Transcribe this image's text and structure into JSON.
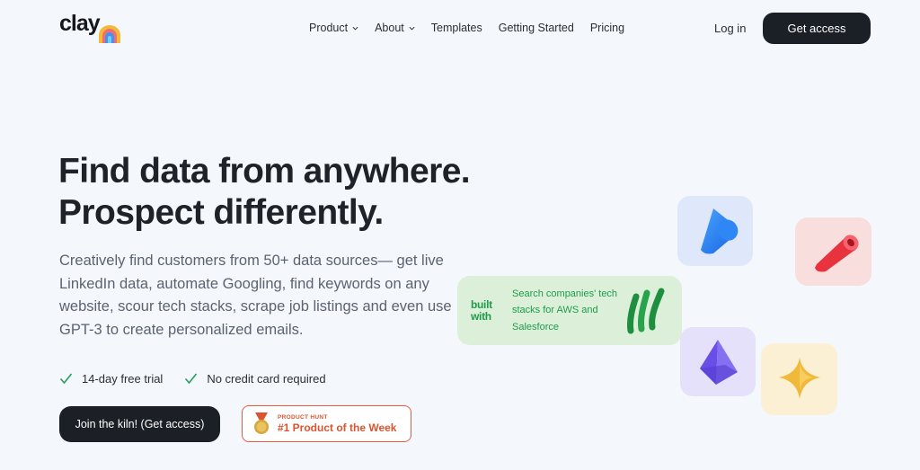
{
  "brand": {
    "name": "clay",
    "arch_colors": [
      "#f5b93a",
      "#ef6f6c",
      "#4a8ef0",
      "#6ad1f2"
    ]
  },
  "nav": {
    "items": [
      {
        "label": "Product",
        "dropdown": true
      },
      {
        "label": "About",
        "dropdown": true
      },
      {
        "label": "Templates",
        "dropdown": false
      },
      {
        "label": "Getting Started",
        "dropdown": false
      },
      {
        "label": "Pricing",
        "dropdown": false
      }
    ],
    "login_label": "Log in",
    "get_access_label": "Get access"
  },
  "hero": {
    "headline_line1": "Find data from anywhere.",
    "headline_line2": "Prospect differently.",
    "subtext": "Creatively find customers from 50+ data sources— get live LinkedIn data, automate Googling, find keywords on any website, scour tech stacks, scrape job listings and even use GPT-3 to create personalized emails.",
    "checks": [
      "14-day free trial",
      "No credit card required"
    ],
    "cta_label": "Join the kiln! (Get access)",
    "product_hunt": {
      "kicker": "PRODUCT HUNT",
      "title": "#1 Product of the Week"
    }
  },
  "integration_card": {
    "logo_line1": "built",
    "logo_line2": "with",
    "text": "Search companies' tech stacks for AWS and Salesforce"
  },
  "colors": {
    "dark": "#1b1f26",
    "accent_green": "#1f9c4b",
    "product_hunt": "#da552f"
  }
}
